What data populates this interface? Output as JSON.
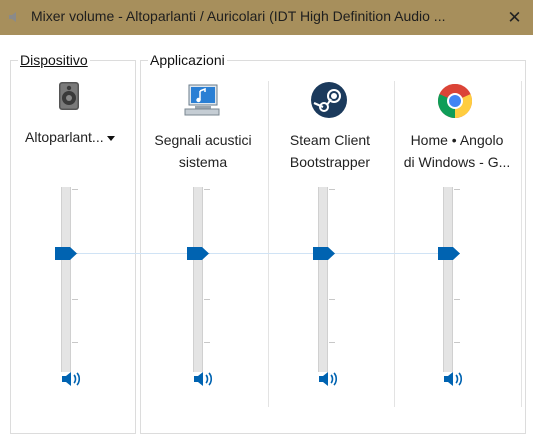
{
  "window": {
    "title": "Mixer volume - Altoparlanti / Auricolari (IDT High Definition Audio ...",
    "close_glyph": "✕"
  },
  "device_group": {
    "label": "Dispositivo",
    "device_name": "Altoparlant...",
    "level": 0.55
  },
  "apps_group": {
    "label": "Applicazioni",
    "apps": [
      {
        "name": "Segnali acustici\nsistema",
        "icon": "system-sounds-icon",
        "level": 0.55
      },
      {
        "name": "Steam Client\nBootstrapper",
        "icon": "steam-icon",
        "level": 0.55
      },
      {
        "name": "Home • Angolo\ndi Windows - G...",
        "icon": "chrome-icon",
        "level": 0.55
      }
    ]
  },
  "colors": {
    "accent": "#0063b1",
    "titlebar": "#a78f5c"
  }
}
